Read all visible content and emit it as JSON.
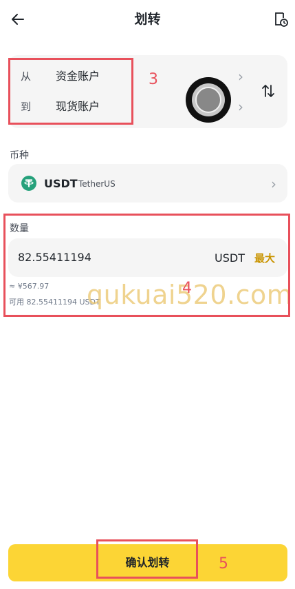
{
  "header": {
    "title": "划转",
    "back_icon": "arrow-left-icon",
    "history_icon": "history-record-icon"
  },
  "transfer": {
    "from_label": "从",
    "from_account": "资金账户",
    "to_label": "到",
    "to_account": "现货账户",
    "swap_icon": "swap-vertical-icon"
  },
  "coin": {
    "section_label": "币种",
    "symbol": "USDT",
    "name": "TetherUS",
    "icon_color": "#26a17b"
  },
  "amount": {
    "section_label": "数量",
    "value": "82.55411194",
    "unit": "USDT",
    "max_label": "最大",
    "approx_value": "≈ ¥567.97",
    "available": "可用 82.55411194 USDT"
  },
  "annotations": {
    "step3": "3",
    "step4": "4",
    "step5": "5",
    "color": "#e8505b"
  },
  "watermark": "qukuai520.com",
  "confirm": {
    "label": "确认划转",
    "color": "#fcd535"
  }
}
